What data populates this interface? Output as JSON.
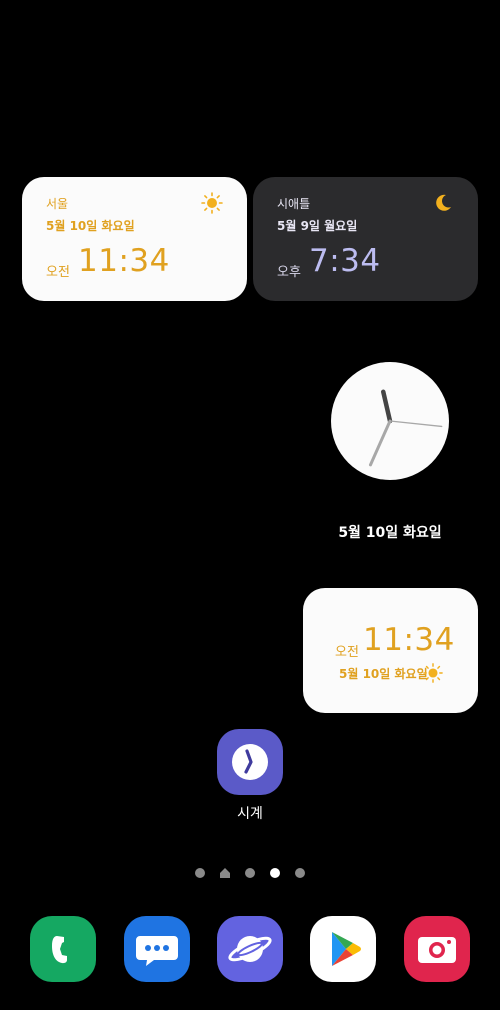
{
  "dual_clock": {
    "home": {
      "city": "서울",
      "date": "5월 10일 화요일",
      "ampm": "오전",
      "time": "11:34",
      "weather_icon": "sun-icon"
    },
    "world": {
      "city": "시애틀",
      "date": "5월 9일 월요일",
      "ampm": "오후",
      "time": "7:34",
      "weather_icon": "moon-icon"
    }
  },
  "analog_clock": {
    "date": "5월 10일 화요일",
    "hour": 11,
    "minute": 34,
    "second": 16
  },
  "digital_clock": {
    "ampm": "오전",
    "time": "11:34",
    "date": "5월 10일 화요일",
    "weather_icon": "sun-icon"
  },
  "app": {
    "label": "시계",
    "icon": "clock-app-icon"
  },
  "page_indicator": {
    "count": 5,
    "active_index": 3,
    "home_index": 1
  },
  "dock": [
    {
      "name": "phone",
      "icon": "phone-icon",
      "color": "#15a862"
    },
    {
      "name": "messages",
      "icon": "messages-icon",
      "color": "#1f74e2"
    },
    {
      "name": "internet",
      "icon": "internet-icon",
      "color": "#6363e0"
    },
    {
      "name": "play-store",
      "icon": "play-store-icon",
      "color": "#ffffff"
    },
    {
      "name": "camera",
      "icon": "camera-icon",
      "color": "#e0254d"
    }
  ],
  "colors": {
    "accent_orange": "#e0a120",
    "widget_dark": "#2b2b2d",
    "widget_light": "#fbfbfb"
  }
}
